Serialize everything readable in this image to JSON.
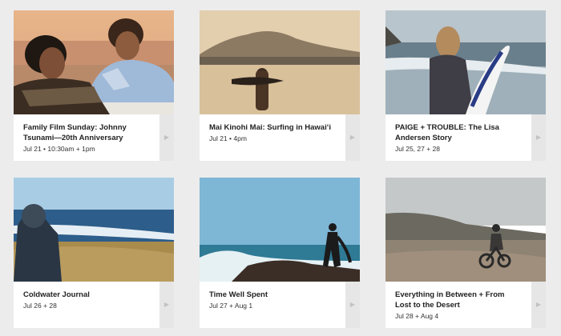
{
  "events": [
    {
      "title": "Family Film Sunday: Johnny Tsunami—20th Anniversary",
      "date": "Jul 21 • 10:30am + 1pm",
      "image": "beach-portrait-scene"
    },
    {
      "title": "Mai Kinohi Mai: Surfing in Hawaiʻi",
      "date": "Jul 21 • 4pm",
      "image": "vintage-surfer-on-beach"
    },
    {
      "title": "PAIGE + TROUBLE: The Lisa Andersen Story",
      "date": "Jul 25, 27 + 28",
      "image": "surfer-with-board"
    },
    {
      "title": "Coldwater Journal",
      "date": "Jul 26 + 28",
      "image": "hooded-figure-coast"
    },
    {
      "title": "Time Well Spent",
      "date": "Jul 27 + Aug 1",
      "image": "surfer-silhouette-rocks"
    },
    {
      "title": "Everything in Between + From Lost to the Desert",
      "date": "Jul 28 + Aug 4",
      "image": "motorbike-on-beach"
    }
  ],
  "chevron_icon": "chevron-right-icon"
}
